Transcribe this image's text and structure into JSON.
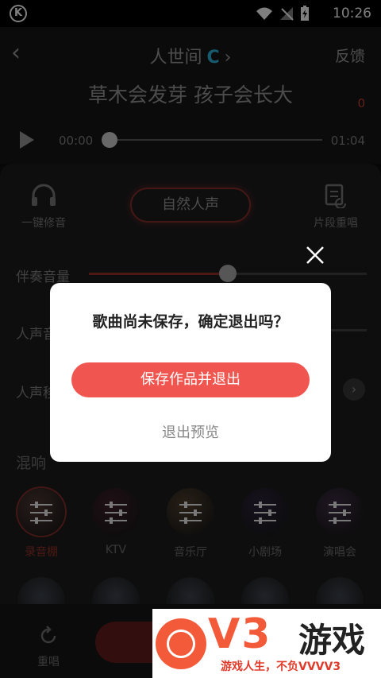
{
  "status_bar": {
    "time": "10:26",
    "app_badge": "K"
  },
  "header": {
    "song_title": "人世间",
    "quality_badge": "C",
    "feedback": "反馈"
  },
  "lyric": {
    "line": "草木会发芽 孩子会长大",
    "count": "0"
  },
  "player": {
    "current_time": "00:00",
    "total_time": "01:04",
    "progress": 0.0
  },
  "tools": {
    "auto_tune_label": "一键修音",
    "voice_mode": "自然人声",
    "segment_label": "片段重唱"
  },
  "sliders": {
    "accompaniment": {
      "label": "伴奏音量",
      "value": 0.5
    },
    "vocal": {
      "label": "人声音"
    },
    "vocal_shift": {
      "label": "人声移"
    }
  },
  "reverb": {
    "title": "混响",
    "items": [
      {
        "label": "录音棚",
        "selected": true,
        "color": "#4a3530"
      },
      {
        "label": "KTV",
        "selected": false,
        "color": "#3a1e28"
      },
      {
        "label": "音乐厅",
        "selected": false,
        "color": "#4a3a2a"
      },
      {
        "label": "小剧场",
        "selected": false,
        "color": "#2a2238"
      },
      {
        "label": "演唱会",
        "selected": false,
        "color": "#3a2a40"
      }
    ]
  },
  "bottom": {
    "resing_label": "重唱"
  },
  "dialog": {
    "message": "歌曲尚未保存，确定退出吗？",
    "primary": "保存作品并退出",
    "secondary": "退出预览"
  },
  "watermark": {
    "brand": "V3",
    "game": "游戏",
    "slogan": "游戏人生，不负VVVV3"
  },
  "colors": {
    "accent": "#f0554f",
    "badge": "#2aa6c8",
    "watermark": "#f25a3a"
  }
}
